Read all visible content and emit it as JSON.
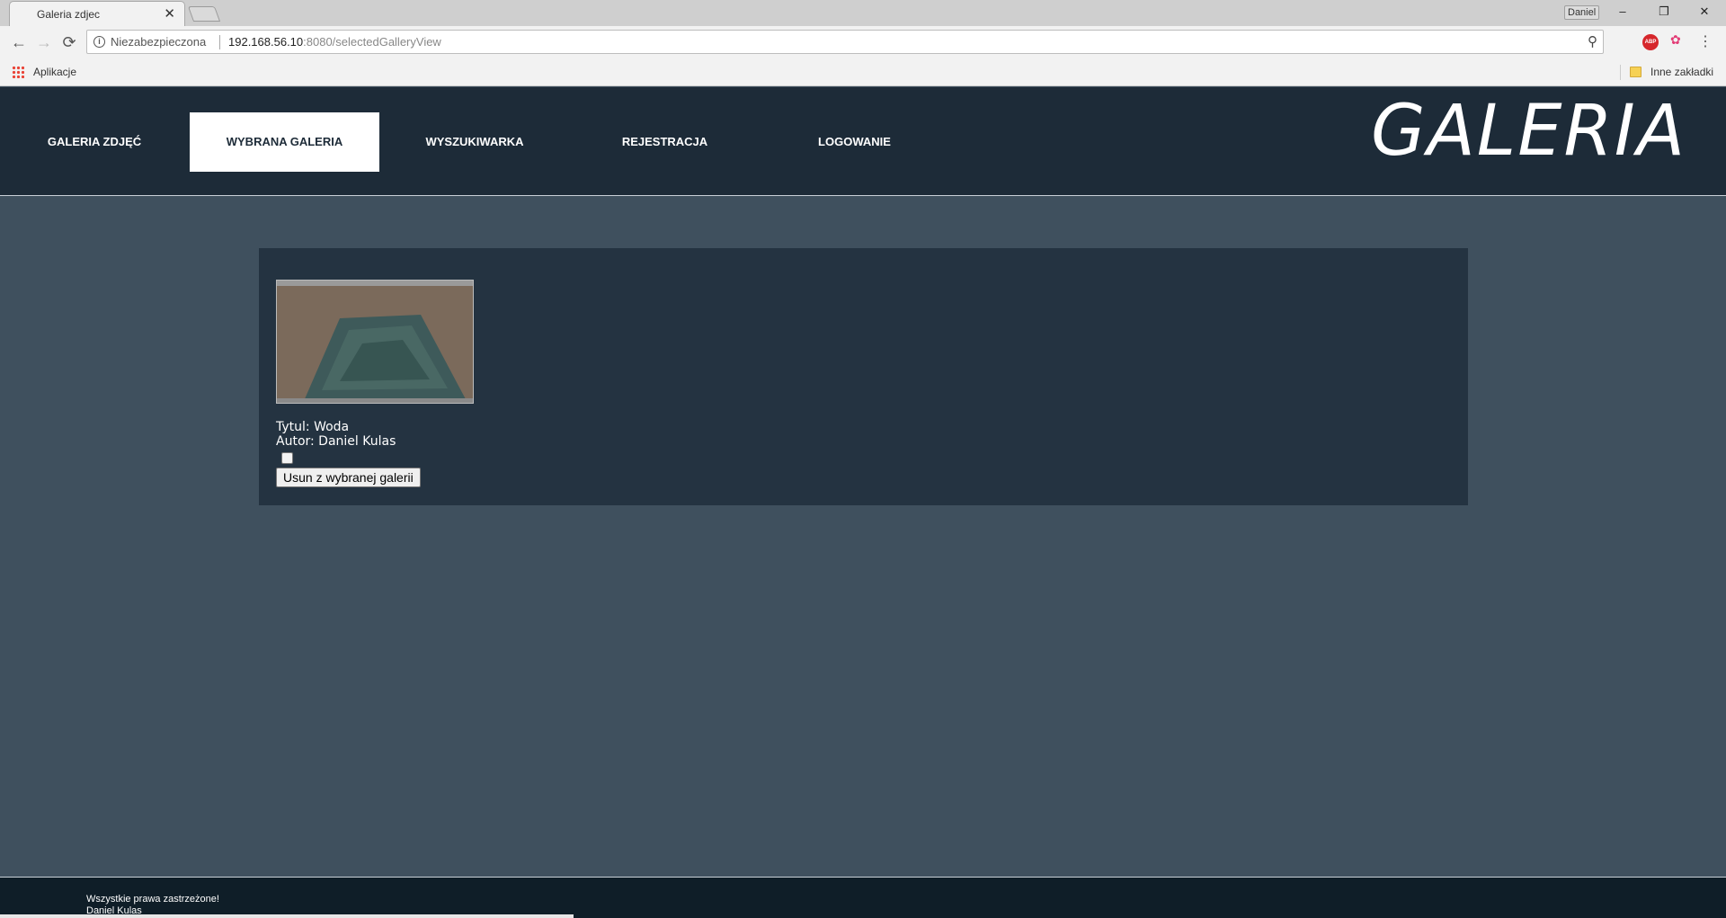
{
  "browser": {
    "tab_title": "Galeria zdjec",
    "tab_close": "✕",
    "profile_name": "Daniel",
    "window_controls": {
      "minimize": "–",
      "restore": "❐",
      "close": "✕"
    },
    "nav": {
      "back": "←",
      "forward": "→",
      "reload": "⟳"
    },
    "security_label": "Niezabezpieczona",
    "url_host": "192.168.56.10",
    "url_rest": ":8080/selectedGalleryView",
    "extensions": {
      "abp": "ABP"
    },
    "bookmarks": {
      "apps_label": "Aplikacje",
      "other_label": "Inne zakładki"
    },
    "icons": [
      "info-icon",
      "zoom-icon",
      "abp-icon",
      "extension-icon",
      "menu-icon",
      "apps-icon",
      "folder-icon"
    ]
  },
  "site": {
    "nav": [
      {
        "label": "GALERIA ZDJĘĆ"
      },
      {
        "label": "WYBRANA GALERIA",
        "active": true
      },
      {
        "label": "WYSZUKIWARKA"
      },
      {
        "label": "REJESTRACJA"
      },
      {
        "label": "LOGOWANIE"
      }
    ],
    "logo": "GALERIA",
    "colors": {
      "header": "#1d2b38",
      "background": "#3f505e",
      "panel": "#243341",
      "footer": "#0f1e28"
    }
  },
  "gallery": {
    "items": [
      {
        "title_line": "Tytul: Woda",
        "author_line": "Autor: Daniel Kulas",
        "checked": false,
        "remove_label": "Usun z wybranej galerii"
      }
    ]
  },
  "footer": {
    "line1": "Wszystkie prawa zastrzeżone!",
    "line2": "Daniel Kulas"
  }
}
